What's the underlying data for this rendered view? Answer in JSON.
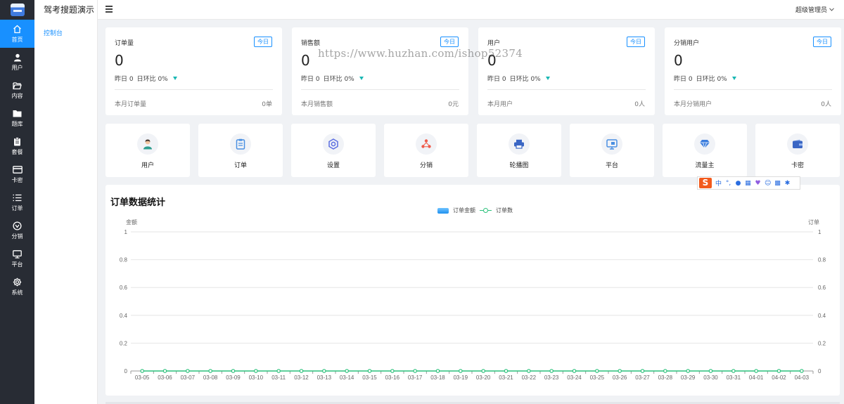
{
  "app": {
    "title": "驾考搜题演示"
  },
  "sidebar": {
    "items": [
      {
        "label": "首页",
        "icon": "home-icon",
        "active": true
      },
      {
        "label": "用户",
        "icon": "user-icon"
      },
      {
        "label": "内容",
        "icon": "folder-open-icon"
      },
      {
        "label": "题库",
        "icon": "folder-icon"
      },
      {
        "label": "套餐",
        "icon": "clipboard-icon"
      },
      {
        "label": "卡密",
        "icon": "card-icon"
      },
      {
        "label": "订单",
        "icon": "list-icon"
      },
      {
        "label": "分销",
        "icon": "distribution-icon"
      },
      {
        "label": "平台",
        "icon": "monitor-icon"
      },
      {
        "label": "系统",
        "icon": "gear-icon"
      }
    ]
  },
  "subnav": {
    "items": [
      {
        "label": "控制台"
      }
    ]
  },
  "header": {
    "user_label": "超级管理员"
  },
  "stats": [
    {
      "title": "订单量",
      "tag": "今日",
      "value": "0",
      "yesterday": "昨日 0",
      "compare": "日环比 0%",
      "month_label": "本月订单量",
      "month_value": "0单"
    },
    {
      "title": "销售额",
      "tag": "今日",
      "value": "0",
      "yesterday": "昨日 0",
      "compare": "日环比 0%",
      "month_label": "本月销售额",
      "month_value": "0元"
    },
    {
      "title": "用户",
      "tag": "今日",
      "value": "0",
      "yesterday": "昨日 0",
      "compare": "日环比 0%",
      "month_label": "本月用户",
      "month_value": "0人"
    },
    {
      "title": "分销用户",
      "tag": "今日",
      "value": "0",
      "yesterday": "昨日 0",
      "compare": "日环比 0%",
      "month_label": "本月分销用户",
      "month_value": "0人"
    }
  ],
  "shortcuts": [
    {
      "label": "用户",
      "icon": "user-avatar-icon",
      "color": "#2f9e8f"
    },
    {
      "label": "订单",
      "icon": "order-icon",
      "color": "#4a90e2"
    },
    {
      "label": "设置",
      "icon": "settings-icon",
      "color": "#5b6ee1"
    },
    {
      "label": "分销",
      "icon": "share-icon",
      "color": "#ef5b4a"
    },
    {
      "label": "轮播图",
      "icon": "printer-icon",
      "color": "#3a66c4"
    },
    {
      "label": "平台",
      "icon": "screen-icon",
      "color": "#4a90e2"
    },
    {
      "label": "流量主",
      "icon": "diamond-icon",
      "color": "#3b7ddd"
    },
    {
      "label": "卡密",
      "icon": "wallet-icon",
      "color": "#3a66c4"
    }
  ],
  "ime": {
    "mode": "中"
  },
  "watermark": "https://www.huzhan.com/ishop52374",
  "chart_panel": {
    "title": "订单数据统计"
  },
  "chart_data": {
    "type": "line",
    "title": "订单数据统计",
    "legend": [
      "订单金额",
      "订单数"
    ],
    "legend_position": "top-center",
    "ylabel_left": "金额",
    "ylabel_right": "订单",
    "ylim": [
      0,
      1
    ],
    "yticks": [
      "0",
      "0.2",
      "0.4",
      "0.6",
      "0.8",
      "1"
    ],
    "grid": true,
    "categories": [
      "03-05",
      "03-06",
      "03-07",
      "03-08",
      "03-09",
      "03-10",
      "03-11",
      "03-12",
      "03-13",
      "03-14",
      "03-15",
      "03-16",
      "03-17",
      "03-18",
      "03-19",
      "03-20",
      "03-21",
      "03-22",
      "03-23",
      "03-24",
      "03-25",
      "03-26",
      "03-27",
      "03-28",
      "03-29",
      "03-30",
      "03-31",
      "04-01",
      "04-02",
      "04-03"
    ],
    "series": [
      {
        "name": "订单金额",
        "type": "bar",
        "color": "#1e90ef",
        "values": [
          0,
          0,
          0,
          0,
          0,
          0,
          0,
          0,
          0,
          0,
          0,
          0,
          0,
          0,
          0,
          0,
          0,
          0,
          0,
          0,
          0,
          0,
          0,
          0,
          0,
          0,
          0,
          0,
          0,
          0
        ]
      },
      {
        "name": "订单数",
        "type": "line",
        "color": "#2bc17b",
        "values": [
          0,
          0,
          0,
          0,
          0,
          0,
          0,
          0,
          0,
          0,
          0,
          0,
          0,
          0,
          0,
          0,
          0,
          0,
          0,
          0,
          0,
          0,
          0,
          0,
          0,
          0,
          0,
          0,
          0,
          0
        ]
      }
    ]
  }
}
